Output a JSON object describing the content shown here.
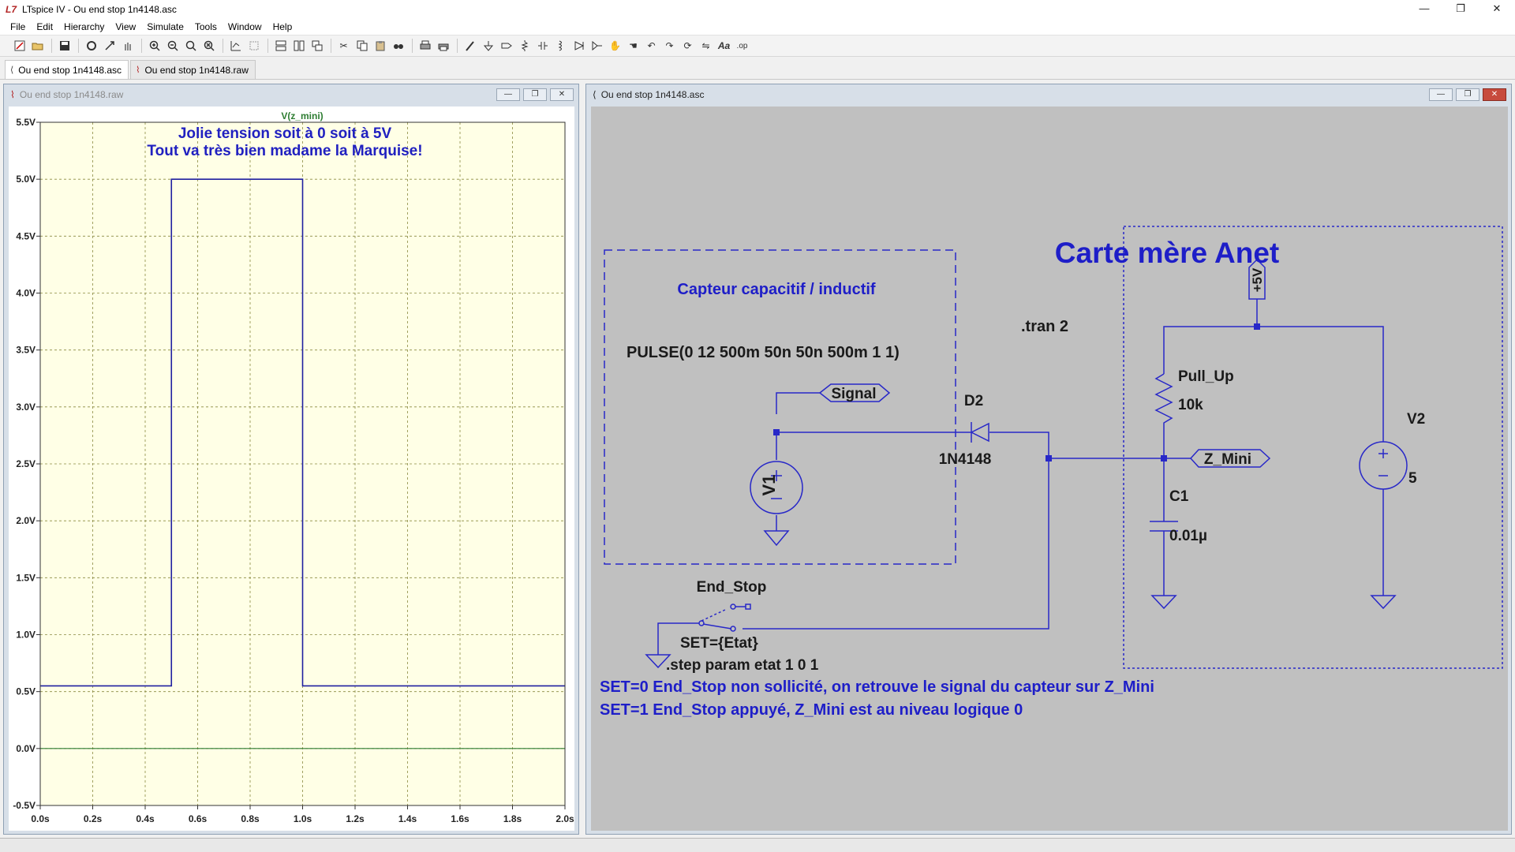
{
  "app": {
    "title": "LTspice IV - Ou end stop 1n4148.asc",
    "icon": "ltspice-icon"
  },
  "window_controls": {
    "minimize": "—",
    "restore": "❐",
    "close": "✕"
  },
  "menu": [
    "File",
    "Edit",
    "Hierarchy",
    "View",
    "Simulate",
    "Tools",
    "Window",
    "Help"
  ],
  "toolbar_icons": [
    "new-schematic-icon",
    "open-icon",
    "save-icon",
    "control-panel-icon",
    "run-icon",
    "halt-icon",
    "zoom-in-icon",
    "zoom-out-icon",
    "zoom-full-icon",
    "zoom-cancel-icon",
    "autorange-icon",
    "zoom-extents-icon",
    "tile-horizontal-icon",
    "tile-vertical-icon",
    "cascade-icon",
    "cut-icon",
    "copy-icon",
    "paste-icon",
    "find-icon",
    "print-icon",
    "print-preview-icon",
    "wire-icon",
    "ground-icon",
    "label-net-icon",
    "resistor-icon",
    "capacitor-icon",
    "inductor-icon",
    "diode-icon",
    "component-icon",
    "move-icon",
    "drag-icon",
    "undo-icon",
    "redo-icon",
    "rotate-icon",
    "mirror-icon",
    "text-icon",
    "spice-directive-icon"
  ],
  "doc_tabs": [
    {
      "label": "Ou end stop 1n4148.asc",
      "icon": "schematic-icon",
      "active": true
    },
    {
      "label": "Ou end stop 1n4148.raw",
      "icon": "waveform-icon",
      "active": false
    }
  ],
  "plot_window": {
    "title": "Ou end stop 1n4148.raw",
    "trace_label": "V(z_mini)",
    "trace_color": "#2020a0",
    "trace_label_color": "#2e7d32",
    "annotation_lines": [
      "Jolie tension soit à 0 soit à 5V",
      "Tout va très bien madame la Marquise!"
    ],
    "annotation_color": "#2020c0",
    "background": "#ffffe6",
    "grid_color": "#8a8a40"
  },
  "chart_data": {
    "type": "line",
    "title": "V(z_mini)",
    "xlabel": "",
    "ylabel": "",
    "xlim": [
      0,
      2.0
    ],
    "ylim": [
      -0.5,
      5.5
    ],
    "x_ticks": [
      "0.0s",
      "0.2s",
      "0.4s",
      "0.6s",
      "0.8s",
      "1.0s",
      "1.2s",
      "1.4s",
      "1.6s",
      "1.8s",
      "2.0s"
    ],
    "y_ticks": [
      "5.5V",
      "5.0V",
      "4.5V",
      "4.0V",
      "3.5V",
      "3.0V",
      "2.5V",
      "2.0V",
      "1.5V",
      "1.0V",
      "0.5V",
      "0.0V",
      "-0.5V"
    ],
    "grid": true,
    "series": [
      {
        "name": "V(z_mini)",
        "x": [
          0.0,
          0.5,
          0.5,
          1.0,
          1.0,
          2.0
        ],
        "y": [
          0.55,
          0.55,
          5.0,
          5.0,
          0.55,
          0.55
        ]
      },
      {
        "x": [
          0.0,
          2.0
        ],
        "y": [
          0.0,
          0.0
        ]
      }
    ]
  },
  "schematic_window": {
    "title": "Ou end stop 1n4148.asc",
    "wire_color": "#2828c8",
    "text_color": "#1a1a1a",
    "comment_color": "#1e1ec8",
    "labels": {
      "sensor_title": "Capteur capacitif / inductif",
      "pulse": "PULSE(0 12 500m 50n 50n 500m 1 1)",
      "signal": "Signal",
      "v1": "V1",
      "tran": ".tran 2",
      "d2": "D2",
      "d2_model": "1N4148",
      "board_title": "Carte mère Anet",
      "plus5v": "+5V",
      "pull_up": "Pull_Up",
      "pull_up_val": "10k",
      "z_mini": "Z_Mini",
      "c1": "C1",
      "c1_val": "0.01µ",
      "v2": "V2",
      "v2_val": "5",
      "end_stop": "End_Stop",
      "set_etat": "SET={Etat}",
      "step": ".step param etat 1 0 1",
      "note1": "SET=0  End_Stop non sollicité, on retrouve le signal du capteur sur Z_Mini",
      "note2": "SET=1  End_Stop appuyé, Z_Mini est au niveau logique 0"
    }
  }
}
